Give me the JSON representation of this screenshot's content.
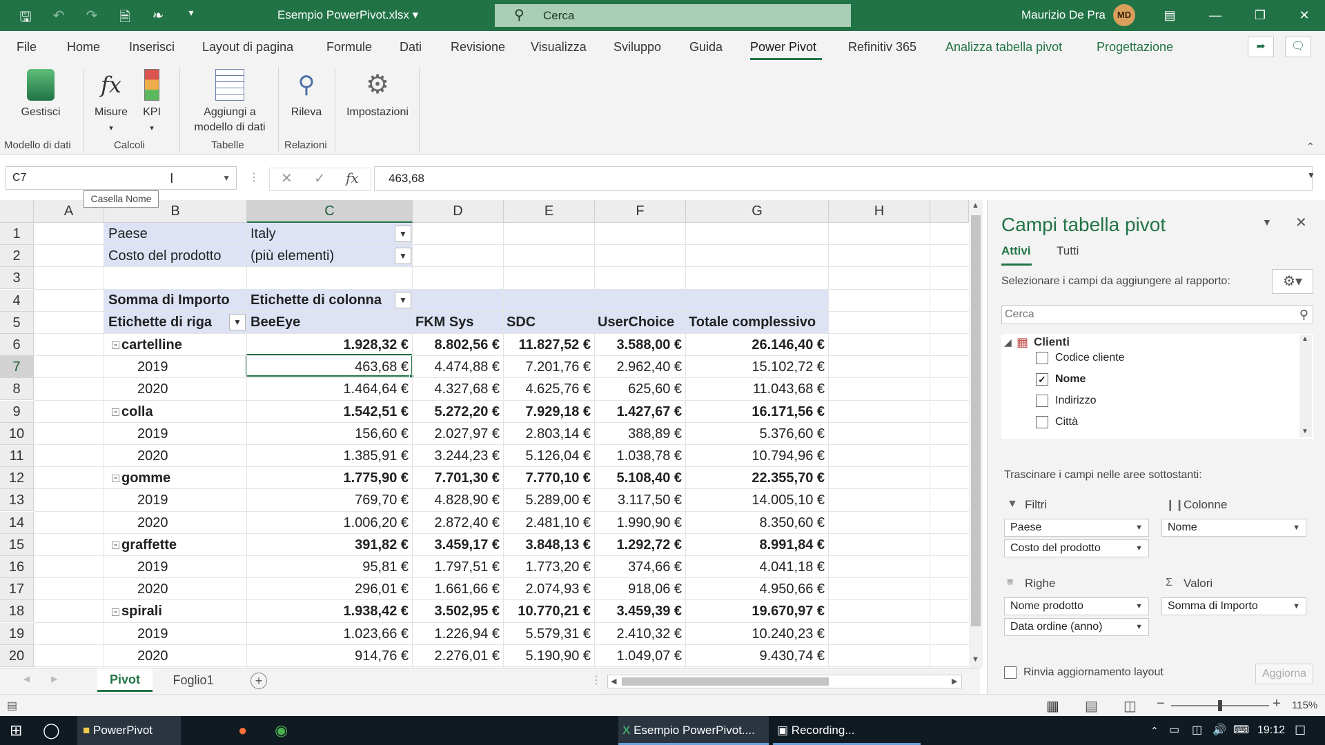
{
  "titlebar": {
    "filename": "Esempio PowerPivot.xlsx",
    "search": "Cerca",
    "user": "Maurizio De Pra",
    "initials": "MD"
  },
  "menu": [
    "File",
    "Home",
    "Inserisci",
    "Layout di pagina",
    "Formule",
    "Dati",
    "Revisione",
    "Visualizza",
    "Sviluppo",
    "Guida",
    "Power Pivot",
    "Refinitiv 365",
    "Analizza tabella pivot",
    "Progettazione"
  ],
  "ribbon": {
    "gestisci": "Gestisci",
    "misure": "Misure",
    "kpi": "KPI",
    "aggiungi1": "Aggiungi a",
    "aggiungi2": "modello di dati",
    "rileva": "Rileva",
    "impostazioni": "Impostazioni",
    "groups": {
      "modello": "Modello di dati",
      "calcoli": "Calcoli",
      "tabelle": "Tabelle",
      "relazioni": "Relazioni"
    }
  },
  "formula": {
    "namebox": "C7",
    "tooltip": "Casella Nome",
    "value": "463,68"
  },
  "columns": [
    "A",
    "B",
    "C",
    "D",
    "E",
    "F",
    "G",
    "H"
  ],
  "rows": [
    "1",
    "2",
    "3",
    "4",
    "5",
    "6",
    "7",
    "8",
    "9",
    "10",
    "11",
    "12",
    "13",
    "14",
    "15",
    "16",
    "17",
    "18",
    "19",
    "20"
  ],
  "pivot": {
    "f1_label": "Paese",
    "f1_value": "Italy",
    "f2_label": "Costo del prodotto",
    "f2_value": "(più elementi)",
    "sum_label": "Somma di Importo",
    "col_labels": "Etichette di colonna",
    "row_labels": "Etichette di riga",
    "col_heads": [
      "BeeEye",
      "FKM Sys",
      "SDC",
      "UserChoice",
      "Totale complessivo"
    ],
    "data": [
      {
        "label": "cartelline",
        "group": true,
        "v": [
          "1.928,32 €",
          "8.802,56 €",
          "11.827,52 €",
          "3.588,00 €",
          "26.146,40 €"
        ]
      },
      {
        "label": "2019",
        "group": false,
        "v": [
          "463,68 €",
          "4.474,88 €",
          "7.201,76 €",
          "2.962,40 €",
          "15.102,72 €"
        ]
      },
      {
        "label": "2020",
        "group": false,
        "v": [
          "1.464,64 €",
          "4.327,68 €",
          "4.625,76 €",
          "625,60 €",
          "11.043,68 €"
        ]
      },
      {
        "label": "colla",
        "group": true,
        "v": [
          "1.542,51 €",
          "5.272,20 €",
          "7.929,18 €",
          "1.427,67 €",
          "16.171,56 €"
        ]
      },
      {
        "label": "2019",
        "group": false,
        "v": [
          "156,60 €",
          "2.027,97 €",
          "2.803,14 €",
          "388,89 €",
          "5.376,60 €"
        ]
      },
      {
        "label": "2020",
        "group": false,
        "v": [
          "1.385,91 €",
          "3.244,23 €",
          "5.126,04 €",
          "1.038,78 €",
          "10.794,96 €"
        ]
      },
      {
        "label": "gomme",
        "group": true,
        "v": [
          "1.775,90 €",
          "7.701,30 €",
          "7.770,10 €",
          "5.108,40 €",
          "22.355,70 €"
        ]
      },
      {
        "label": "2019",
        "group": false,
        "v": [
          "769,70 €",
          "4.828,90 €",
          "5.289,00 €",
          "3.117,50 €",
          "14.005,10 €"
        ]
      },
      {
        "label": "2020",
        "group": false,
        "v": [
          "1.006,20 €",
          "2.872,40 €",
          "2.481,10 €",
          "1.990,90 €",
          "8.350,60 €"
        ]
      },
      {
        "label": "graffette",
        "group": true,
        "v": [
          "391,82 €",
          "3.459,17 €",
          "3.848,13 €",
          "1.292,72 €",
          "8.991,84 €"
        ]
      },
      {
        "label": "2019",
        "group": false,
        "v": [
          "95,81 €",
          "1.797,51 €",
          "1.773,20 €",
          "374,66 €",
          "4.041,18 €"
        ]
      },
      {
        "label": "2020",
        "group": false,
        "v": [
          "296,01 €",
          "1.661,66 €",
          "2.074,93 €",
          "918,06 €",
          "4.950,66 €"
        ]
      },
      {
        "label": "spirali",
        "group": true,
        "v": [
          "1.938,42 €",
          "3.502,95 €",
          "10.770,21 €",
          "3.459,39 €",
          "19.670,97 €"
        ]
      },
      {
        "label": "2019",
        "group": false,
        "v": [
          "1.023,66 €",
          "1.226,94 €",
          "5.579,31 €",
          "2.410,32 €",
          "10.240,23 €"
        ]
      },
      {
        "label": "2020",
        "group": false,
        "v": [
          "914,76 €",
          "2.276,01 €",
          "5.190,90 €",
          "1.049,07 €",
          "9.430,74 €"
        ]
      }
    ]
  },
  "sheets": {
    "active": "Pivot",
    "other": "Foglio1"
  },
  "pane": {
    "title": "Campi tabella pivot",
    "tab_active": "Attivi",
    "tab_all": "Tutti",
    "instruction": "Selezionare i campi da aggiungere al rapporto:",
    "search": "Cerca",
    "table": "Clienti",
    "fields": [
      {
        "name": "Codice cliente",
        "checked": false
      },
      {
        "name": "Nome",
        "checked": true
      },
      {
        "name": "Indirizzo",
        "checked": false
      },
      {
        "name": "Città",
        "checked": false
      }
    ],
    "drag_text": "Trascinare i campi nelle aree sottostanti:",
    "areas": {
      "filtri": "Filtri",
      "colonne": "Colonne",
      "righe": "Righe",
      "valori": "Valori"
    },
    "filtri_items": [
      "Paese",
      "Costo del prodotto"
    ],
    "colonne_items": [
      "Nome"
    ],
    "righe_items": [
      "Nome prodotto",
      "Data ordine (anno)"
    ],
    "valori_items": [
      "Somma di Importo"
    ],
    "defer": "Rinvia aggiornamento layout",
    "update": "Aggiorna"
  },
  "status": {
    "zoom": "115%"
  },
  "taskbar": {
    "folder": "PowerPivot",
    "excel": "Esempio PowerPivot....",
    "rec": "Recording...",
    "time": "19:12"
  }
}
